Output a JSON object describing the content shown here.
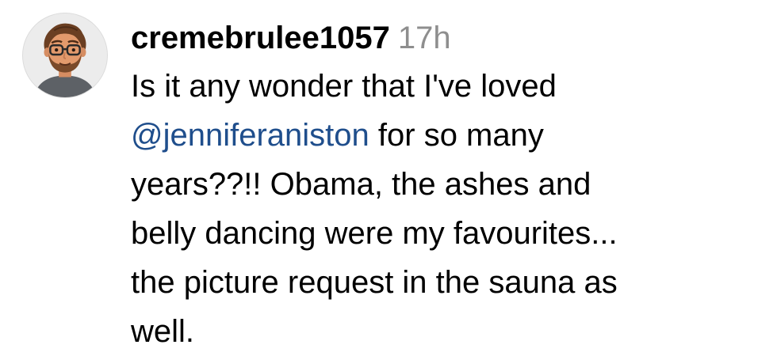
{
  "comment": {
    "avatar_icon": "memoji-avatar-icon",
    "username": "cremebrulee1057",
    "timestamp": "17h",
    "line1": "Is it any wonder that I've loved",
    "mention": "@jenniferaniston",
    "line2_rest": " for so many",
    "line3": "years??!! Obama, the ashes and",
    "line4": "belly dancing were my favourites...",
    "line5": "the picture request in the sauna as",
    "line6": "well."
  },
  "colors": {
    "background": "#ffffff",
    "text": "#000000",
    "timestamp": "#8e8e8e",
    "mention": "#1f4e8c"
  }
}
